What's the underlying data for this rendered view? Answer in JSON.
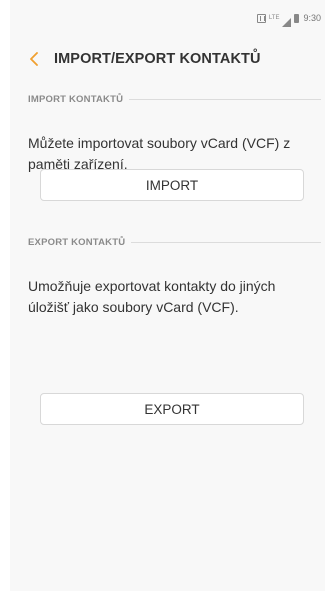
{
  "status_bar": {
    "lte": "LTE",
    "clock": "9:30"
  },
  "header": {
    "title": "IMPORT/EXPORT KONTAKTŮ",
    "back_color": "#f0a030"
  },
  "import_section": {
    "heading": "IMPORT KONTAKTŮ",
    "description": "Můžete importovat soubory vCard (VCF) z paměti zařízení.",
    "button_label": "IMPORT"
  },
  "export_section": {
    "heading": "EXPORT KONTAKTŮ",
    "description": "Umožňuje exportovat kontakty do jiných úložišť jako soubory vCard (VCF).",
    "button_label": "EXPORT"
  }
}
